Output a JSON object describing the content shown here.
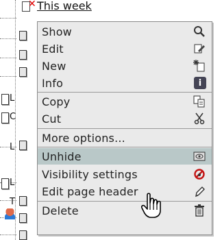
{
  "tree": {
    "top_item_label": "This week",
    "node_letters": [
      "L",
      "C",
      "L",
      "L",
      "T"
    ]
  },
  "menu": {
    "items": [
      {
        "label": "Show",
        "icon": "magnifier-icon"
      },
      {
        "label": "Edit",
        "icon": "edit-icon"
      },
      {
        "label": "New",
        "icon": "new-icon"
      },
      {
        "label": "Info",
        "icon": "info-icon"
      },
      {
        "label": "Copy",
        "icon": "copy-icon"
      },
      {
        "label": "Cut",
        "icon": "scissors-icon"
      },
      {
        "label": "More options...",
        "icon": ""
      },
      {
        "label": "Unhide",
        "icon": "unhide-icon"
      },
      {
        "label": "Visibility settings",
        "icon": "visibility-icon"
      },
      {
        "label": "Edit page header",
        "icon": "pencil-icon"
      },
      {
        "label": "Delete",
        "icon": "trash-icon"
      }
    ],
    "highlighted_index": 7,
    "colors": {
      "background": "#eaeaea",
      "highlight": "#b9c8c8",
      "border": "#8a8a8a"
    }
  }
}
